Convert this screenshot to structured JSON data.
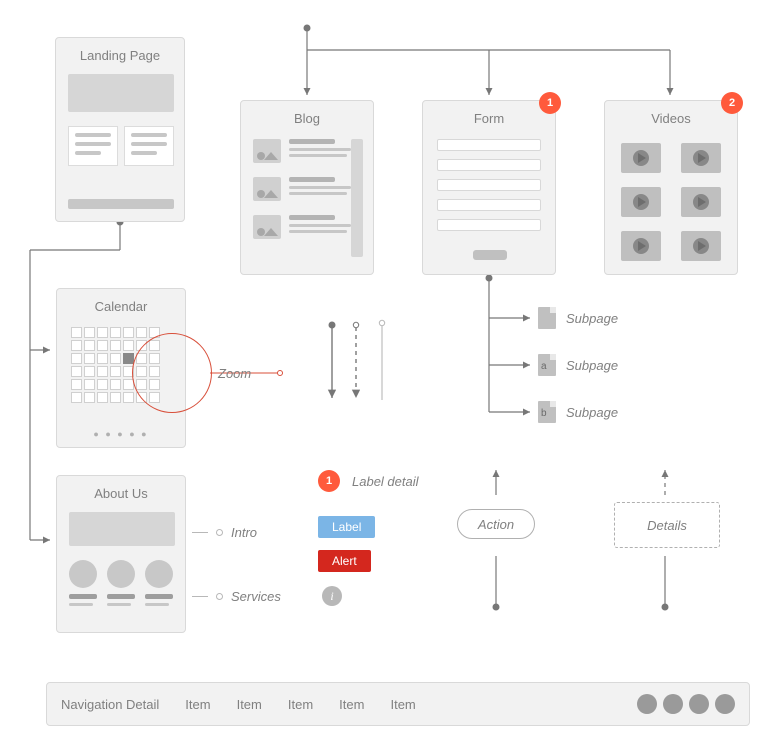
{
  "pages": {
    "landing": {
      "title": "Landing Page"
    },
    "blog": {
      "title": "Blog"
    },
    "form": {
      "title": "Form",
      "badge": "1"
    },
    "videos": {
      "title": "Videos",
      "badge": "2"
    },
    "calendar": {
      "title": "Calendar"
    },
    "about": {
      "title": "About Us"
    }
  },
  "subpages": [
    {
      "label": "Subpage",
      "mark": ""
    },
    {
      "label": "Subpage",
      "mark": "a"
    },
    {
      "label": "Subpage",
      "mark": "b"
    }
  ],
  "annotations": {
    "zoom": "Zoom",
    "intro": "Intro",
    "services": "Services",
    "label_detail": "Label detail",
    "label": "Label",
    "alert": "Alert",
    "action": "Action",
    "details": "Details",
    "badge1": "1",
    "info": "i"
  },
  "nav": {
    "title": "Navigation Detail",
    "items": [
      "Item",
      "Item",
      "Item",
      "Item",
      "Item"
    ]
  }
}
